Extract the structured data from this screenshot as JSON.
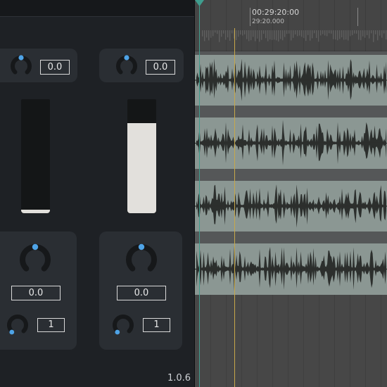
{
  "plugin": {
    "version": "1.0.6",
    "strip_left": {
      "top_value": "0.0",
      "fader_level": 0.03,
      "main_value": "0.0",
      "small_value": "1"
    },
    "strip_right": {
      "top_value": "0.0",
      "fader_level": 0.79,
      "main_value": "0.0",
      "small_value": "1"
    }
  },
  "timeline": {
    "timecode_main": "00:29:20:00",
    "timecode_sub": "29:20.000",
    "tracks": 4
  },
  "colors": {
    "panel_bg": "#1e2125",
    "card_bg": "#2a2e33",
    "knob_accent": "#4ea3e6",
    "lane_bg": "#8b9793",
    "waveform": "#2c2f2d",
    "playhead": "#c8a84a",
    "cursor_line": "#3f9d8e"
  },
  "icons": [
    "knob-icon",
    "playhead-marker-icon"
  ]
}
